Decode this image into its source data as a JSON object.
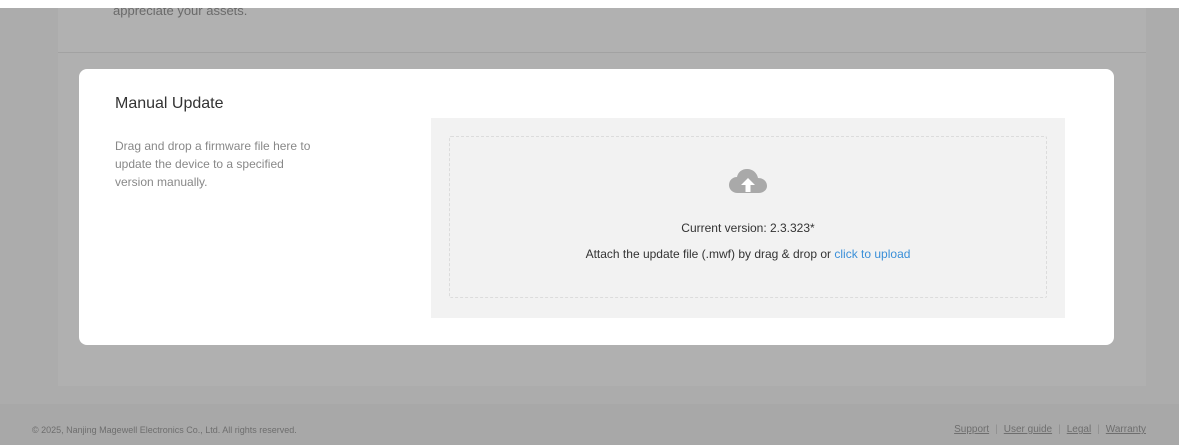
{
  "previous_section": {
    "text_fragment": "appreciate your assets."
  },
  "manual_update": {
    "title": "Manual Update",
    "description": "Drag and drop a firmware file here to update the device to a specified version manually.",
    "upload_icon": "cloud-upload-icon",
    "current_version": "Current version: 2.3.323*",
    "attach_prefix": "Attach the update file (.mwf) by drag & drop or ",
    "upload_link": "click to upload"
  },
  "footer": {
    "copyright": "© 2025, Nanjing Magewell Electronics Co., Ltd. All rights reserved.",
    "links": [
      "Support",
      "User guide",
      "Legal",
      "Warranty"
    ]
  },
  "colors": {
    "overlay_background": "#acacac",
    "card_background": "#ffffff",
    "dropzone_background": "#f2f2f2",
    "link_blue": "#3a8fd8"
  }
}
